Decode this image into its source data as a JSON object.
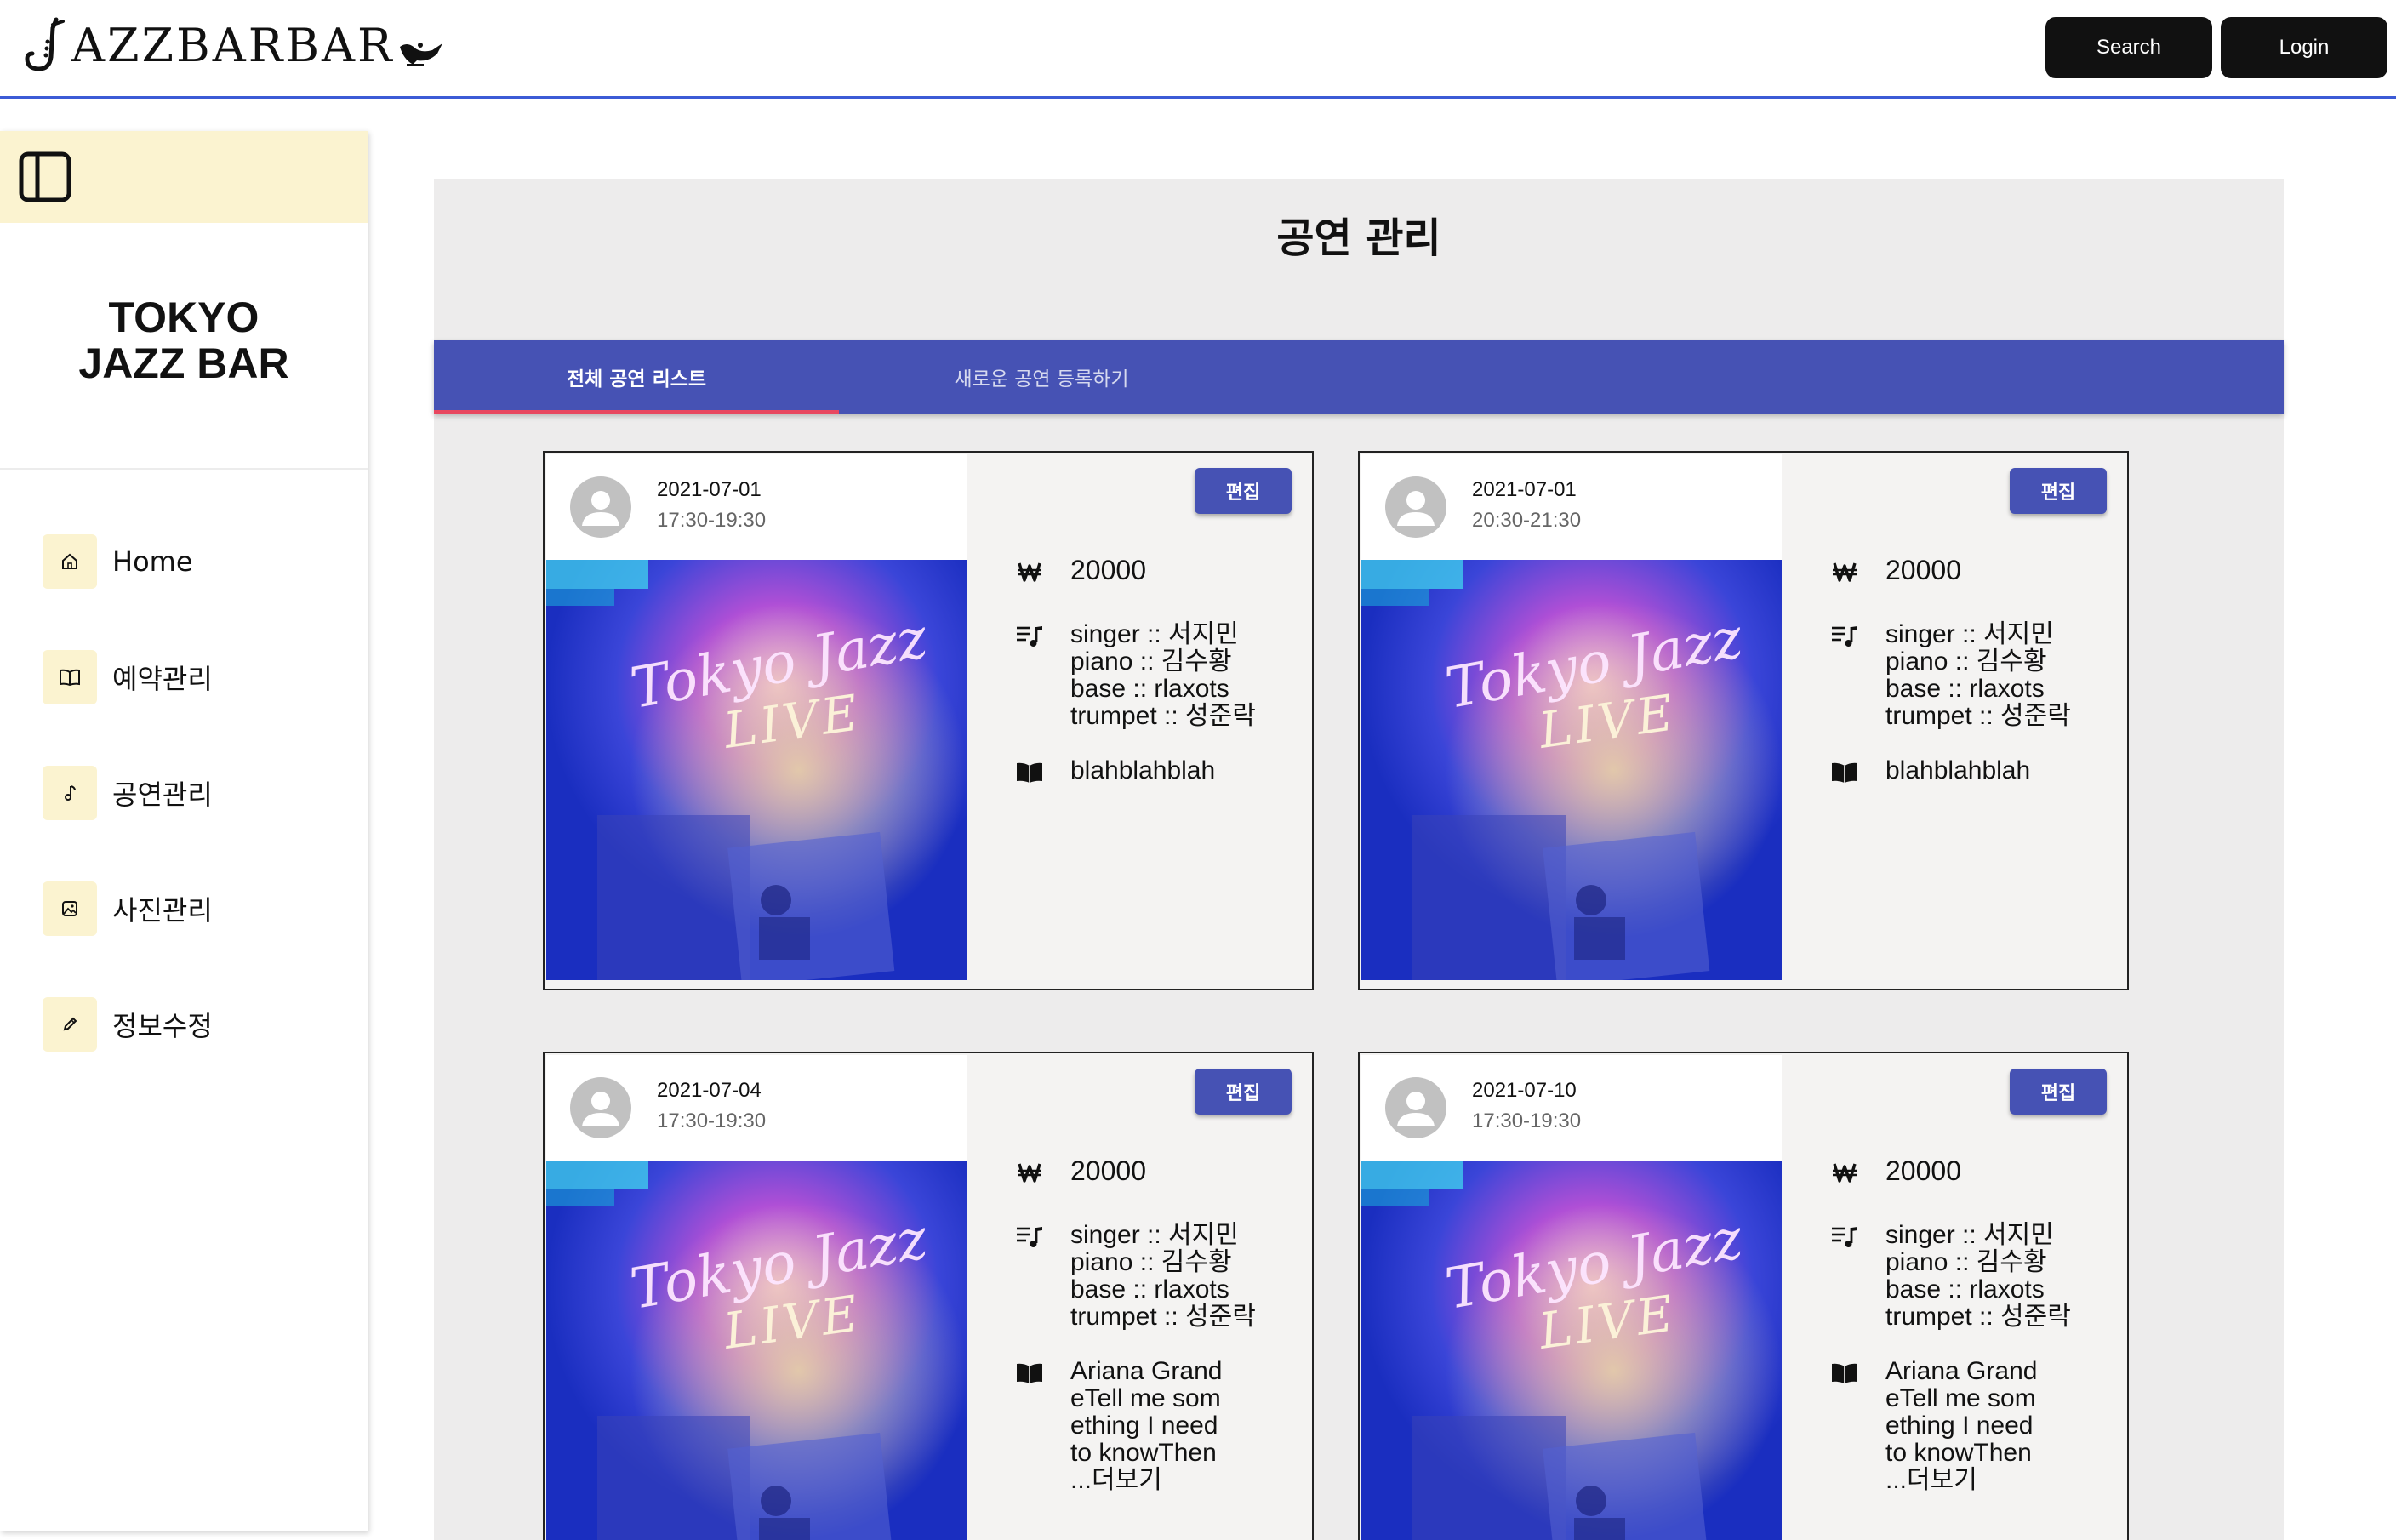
{
  "header": {
    "logo_text": "AZZBARBAR",
    "search_label": "Search",
    "login_label": "Login"
  },
  "sidebar": {
    "toggle_icon": "sidebar-panel-icon",
    "title_line1": "TOKYO",
    "title_line2": "JAZZ BAR",
    "items": [
      {
        "label": "Home",
        "icon": "home-icon"
      },
      {
        "label": "예약관리",
        "icon": "book-icon"
      },
      {
        "label": "공연관리",
        "icon": "music-note-icon"
      },
      {
        "label": "사진관리",
        "icon": "image-icon"
      },
      {
        "label": "정보수정",
        "icon": "pencil-icon"
      }
    ]
  },
  "main": {
    "title": "공연 관리",
    "tabs": [
      {
        "label": "전체 공연 리스트",
        "active": true
      },
      {
        "label": "새로운 공연 등록하기",
        "active": false
      }
    ]
  },
  "cards": [
    {
      "date": "2021-07-01",
      "time": "17:30-19:30",
      "edit_label": "편집",
      "price": "20000",
      "lineup": [
        "singer :: 서지민",
        "piano :: 김수황",
        "base :: rlaxots",
        "trumpet :: 성준락"
      ],
      "description": [
        "blahblahblah"
      ]
    },
    {
      "date": "2021-07-01",
      "time": "20:30-21:30",
      "edit_label": "편집",
      "price": "20000",
      "lineup": [
        "singer :: 서지민",
        "piano :: 김수황",
        "base :: rlaxots",
        "trumpet :: 성준락"
      ],
      "description": [
        "blahblahblah"
      ]
    },
    {
      "date": "2021-07-04",
      "time": "17:30-19:30",
      "edit_label": "편집",
      "price": "20000",
      "lineup": [
        "singer :: 서지민",
        "piano :: 김수황",
        "base :: rlaxots",
        "trumpet :: 성준락"
      ],
      "description": [
        "Ariana Grand",
        "eTell me som",
        "ething I need",
        "to knowThen",
        "...더보기"
      ]
    },
    {
      "date": "2021-07-10",
      "time": "17:30-19:30",
      "edit_label": "편집",
      "price": "20000",
      "lineup": [
        "singer :: 서지민",
        "piano :: 김수황",
        "base :: rlaxots",
        "trumpet :: 성준락"
      ],
      "description": [
        "Ariana Grand",
        "eTell me som",
        "ething I need",
        "to knowThen",
        "...더보기"
      ]
    }
  ],
  "poster": {
    "neon_text_1": "Tokyo Jazz",
    "neon_text_2": "LIVE"
  },
  "colors": {
    "accent": "#4652b4",
    "tab_indicator": "#e8475f",
    "sidebar_highlight": "#fbf3d0",
    "header_button": "#111111",
    "header_rule": "#3c5bd6"
  }
}
